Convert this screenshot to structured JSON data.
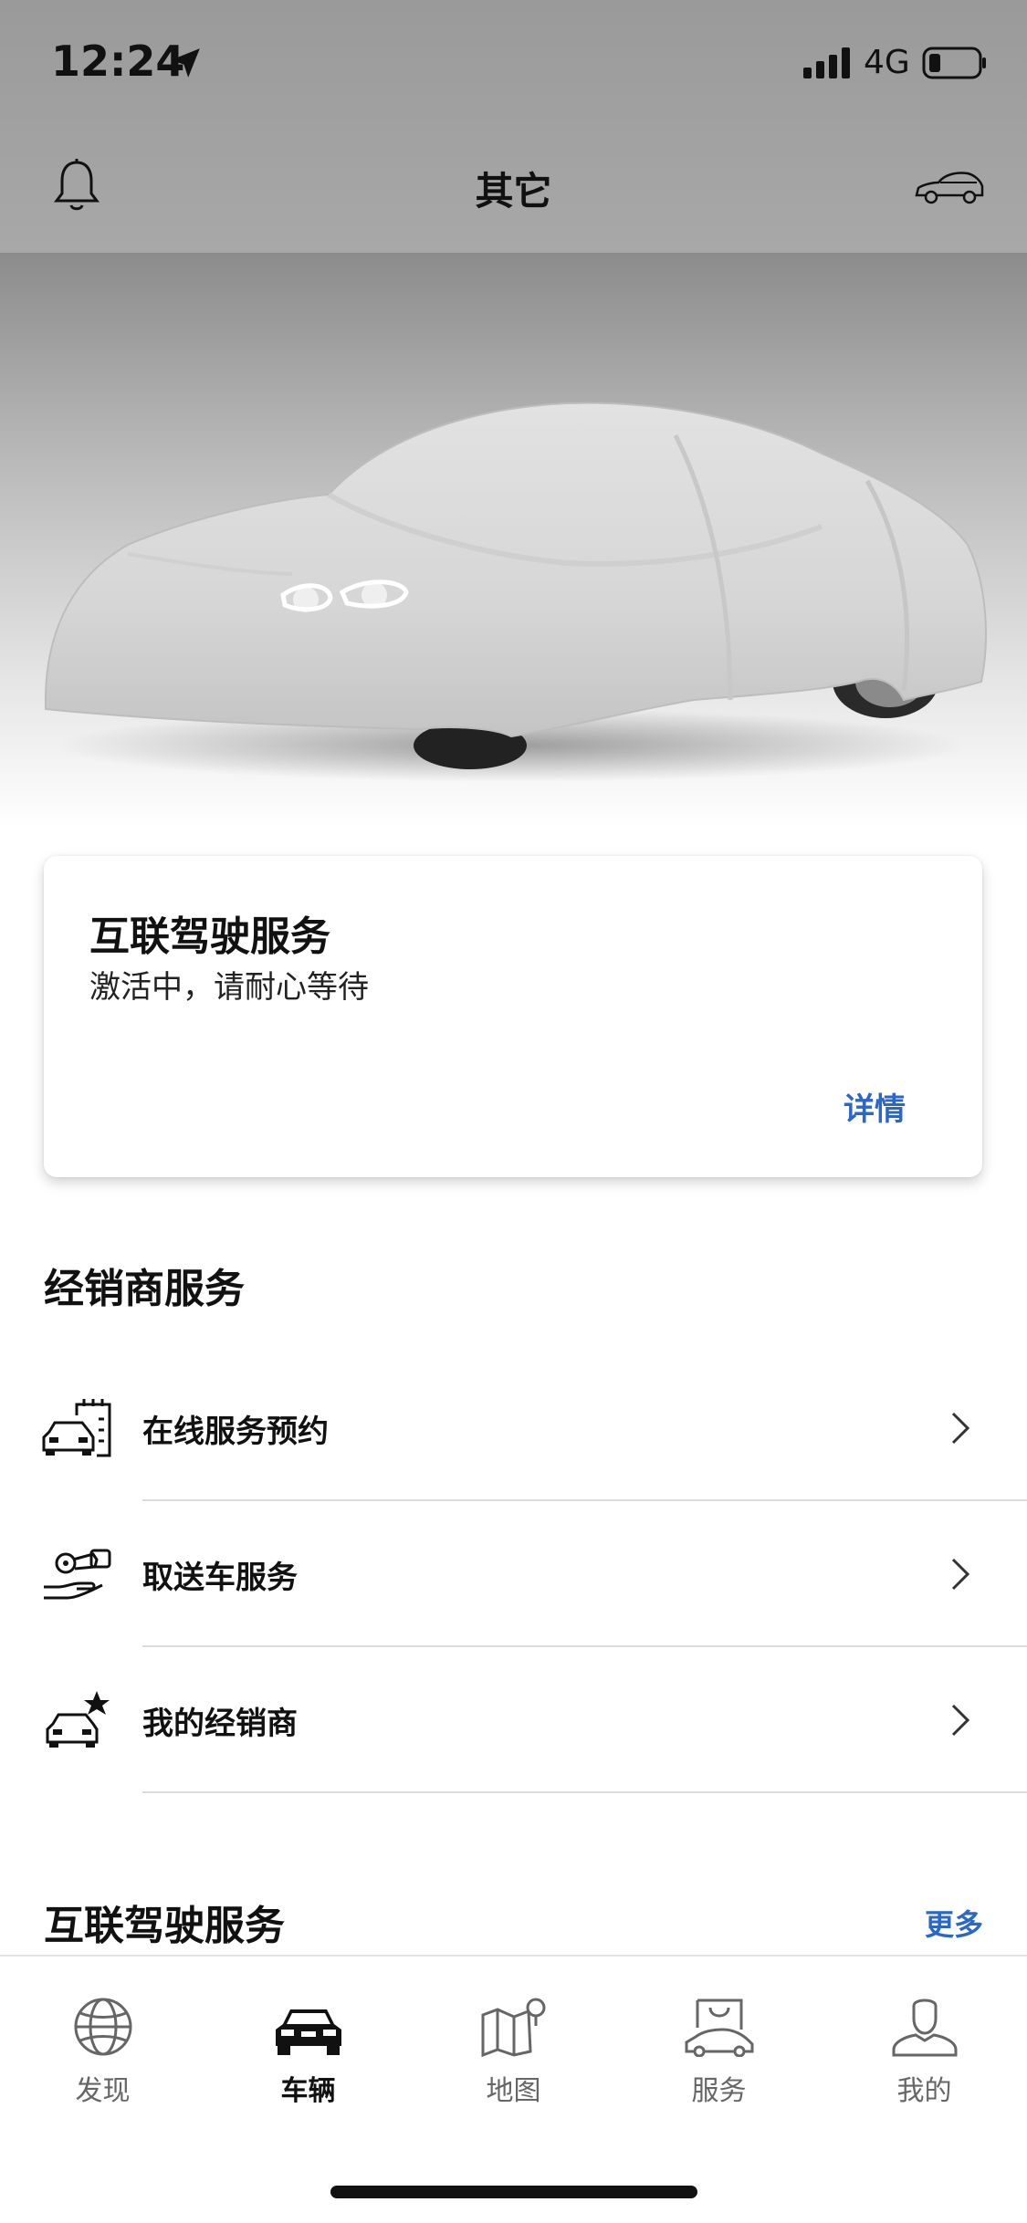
{
  "status_bar": {
    "time": "12:24",
    "network": "4G"
  },
  "header": {
    "title": "其它"
  },
  "card": {
    "title": "互联驾驶服务",
    "subtitle": "激活中，请耐心等待",
    "link": "详情"
  },
  "dealer_section": {
    "title": "经销商服务",
    "items": [
      {
        "label": "在线服务预约",
        "icon": "car-calendar-icon"
      },
      {
        "label": "取送车服务",
        "icon": "key-hand-icon"
      },
      {
        "label": "我的经销商",
        "icon": "car-star-icon"
      }
    ]
  },
  "connected_section": {
    "title": "互联驾驶服务",
    "more": "更多"
  },
  "tabbar": {
    "tabs": [
      {
        "label": "发现",
        "icon": "globe-icon"
      },
      {
        "label": "车辆",
        "icon": "car-icon",
        "active": true
      },
      {
        "label": "地图",
        "icon": "map-icon"
      },
      {
        "label": "服务",
        "icon": "shopping-car-icon"
      },
      {
        "label": "我的",
        "icon": "person-icon"
      }
    ]
  },
  "colors": {
    "accent": "#2a67c7",
    "header_bg": "#a3a3a3"
  }
}
